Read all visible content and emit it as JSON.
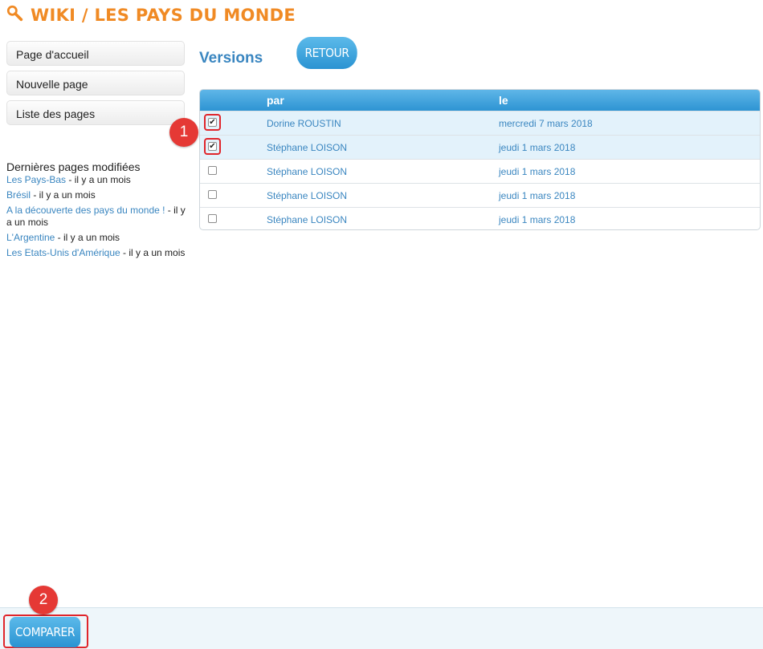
{
  "header": {
    "title": "WIKI / LES PAYS DU MONDE",
    "icon": "search-icon",
    "color": "#f08a24"
  },
  "sidebar": {
    "nav": [
      {
        "label": "Page d'accueil"
      },
      {
        "label": "Nouvelle page"
      },
      {
        "label": "Liste des pages"
      }
    ],
    "recent_title": "Dernières pages modifiées",
    "recent": [
      {
        "link": "Les Pays-Bas",
        "when": " - il y a un mois"
      },
      {
        "link": "Brésil",
        "when": " - il y a un mois"
      },
      {
        "link": "A la découverte des pays du monde !",
        "when": " - il y a un mois"
      },
      {
        "link": "L'Argentine",
        "when": " - il y a un mois"
      },
      {
        "link": "Les Etats-Unis d'Amérique",
        "when": " - il y a un mois"
      }
    ]
  },
  "main": {
    "title": "Versions",
    "back_label": "RETOUR",
    "columns": {
      "by": "par",
      "date": "le"
    },
    "rows": [
      {
        "author": "Dorine ROUSTIN",
        "date": "mercredi 7 mars 2018",
        "checked": true
      },
      {
        "author": "Stéphane LOISON",
        "date": "jeudi 1 mars 2018",
        "checked": true
      },
      {
        "author": "Stéphane LOISON",
        "date": "jeudi 1 mars 2018",
        "checked": false
      },
      {
        "author": "Stéphane LOISON",
        "date": "jeudi 1 mars 2018",
        "checked": false
      },
      {
        "author": "Stéphane LOISON",
        "date": "jeudi 1 mars 2018",
        "checked": false
      }
    ]
  },
  "annotations": {
    "step1": "1",
    "step2": "2",
    "color": "#e53935"
  },
  "footer": {
    "compare_label": "COMPARER"
  },
  "colors": {
    "accent": "#2a93d2",
    "link": "#3a86c0",
    "selected_row": "#e3f2fb"
  }
}
